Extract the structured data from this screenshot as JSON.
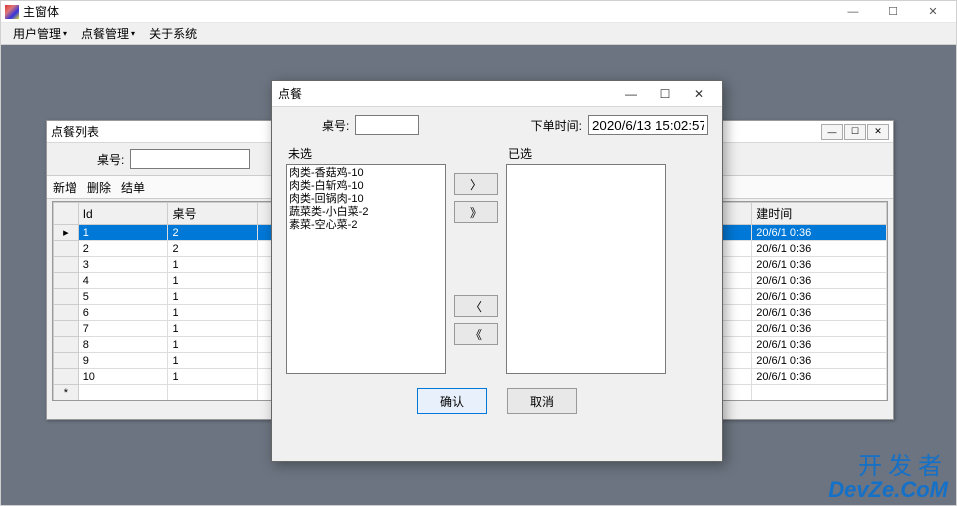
{
  "main_window": {
    "title": "主窗体",
    "menu": [
      {
        "label": "用户管理",
        "has_dropdown": true
      },
      {
        "label": "点餐管理",
        "has_dropdown": true
      },
      {
        "label": "关于系统",
        "has_dropdown": false
      }
    ]
  },
  "list_window": {
    "title": "点餐列表",
    "filter_label": "桌号:",
    "filter_value": "",
    "toolbar": [
      "新增",
      "删除",
      "结单"
    ],
    "columns": [
      "Id",
      "桌号",
      "建时间"
    ],
    "rows": [
      {
        "id": "1",
        "desk": "2",
        "time": "20/6/1 0:36",
        "selected": true
      },
      {
        "id": "2",
        "desk": "2",
        "time": "20/6/1 0:36"
      },
      {
        "id": "3",
        "desk": "1",
        "time": "20/6/1 0:36"
      },
      {
        "id": "4",
        "desk": "1",
        "time": "20/6/1 0:36"
      },
      {
        "id": "5",
        "desk": "1",
        "time": "20/6/1 0:36"
      },
      {
        "id": "6",
        "desk": "1",
        "time": "20/6/1 0:36"
      },
      {
        "id": "7",
        "desk": "1",
        "time": "20/6/1 0:36"
      },
      {
        "id": "8",
        "desk": "1",
        "time": "20/6/1 0:36"
      },
      {
        "id": "9",
        "desk": "1",
        "time": "20/6/1 0:36"
      },
      {
        "id": "10",
        "desk": "1",
        "time": "20/6/1 0:36"
      }
    ]
  },
  "dialog": {
    "title": "点餐",
    "desk_label": "桌号:",
    "desk_value": "",
    "time_label": "下单时间:",
    "time_value": "2020/6/13 15:02:57",
    "unselected_label": "未选",
    "selected_label": "已选",
    "unselected_items": [
      "肉类-香菇鸡-10",
      "肉类-白斩鸡-10",
      "肉类-回锅肉-10",
      "蔬菜类-小白菜-2",
      "素菜-空心菜-2"
    ],
    "selected_items": [],
    "buttons": {
      "right": "〉",
      "right_all": "》",
      "left": "〈",
      "left_all": "《"
    },
    "ok": "确认",
    "cancel": "取消"
  },
  "watermark": {
    "cn": "开发者",
    "en": "DevZe.CoM"
  }
}
